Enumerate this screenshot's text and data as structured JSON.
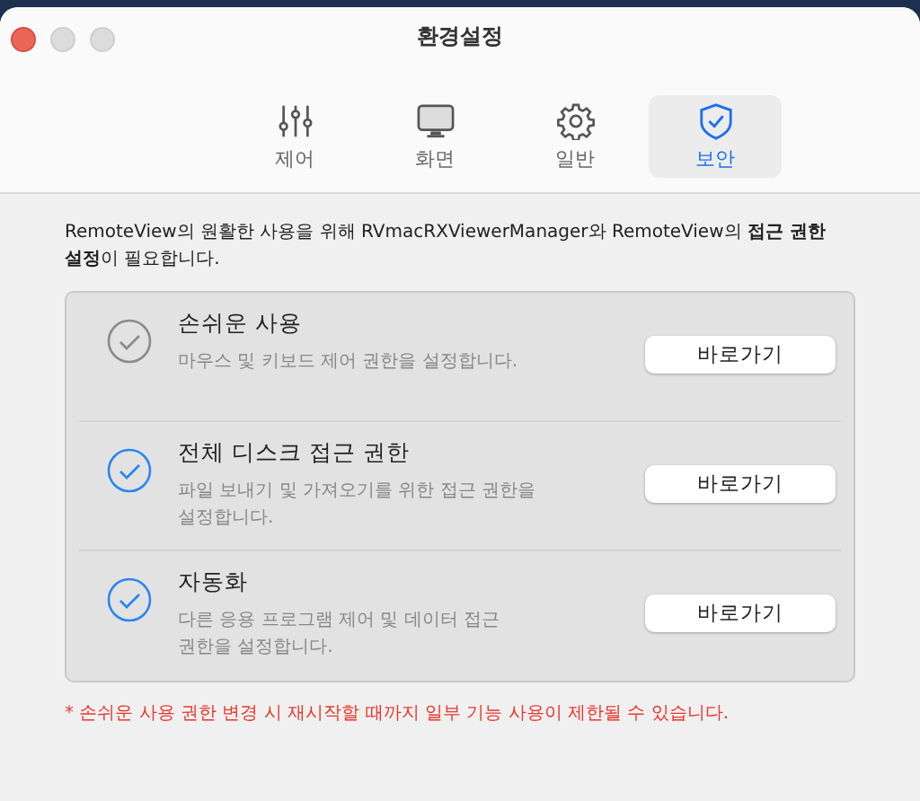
{
  "window": {
    "title": "환경설정"
  },
  "tabs": [
    {
      "label": "제어",
      "kind": "sliders",
      "selected": false
    },
    {
      "label": "화면",
      "kind": "monitor",
      "selected": false
    },
    {
      "label": "일반",
      "kind": "gear",
      "selected": false
    },
    {
      "label": "보안",
      "kind": "shield",
      "selected": true
    }
  ],
  "intro": "RemoteView의 원활한 사용을 위해 RVmacRXViewerManager와 RemoteView의 **접근 권한 설정**이 필요합니다.",
  "permissions": [
    {
      "title": "손쉬운 사용",
      "description": "마우스 및 키보드 제어 권한을 설정합니다.",
      "granted": false,
      "button": "바로가기"
    },
    {
      "title": "전체 디스크 접근 권한",
      "description": "파일 보내기 및 가져오기를 위한 접근 권한을 설정합니다.",
      "granted": true,
      "button": "바로가기"
    },
    {
      "title": "자동화",
      "description": "다른 응용 프로그램 제어 및 데이터 접근 권한을 설정합니다.",
      "granted": true,
      "button": "바로가기"
    }
  ],
  "note": "* 손쉬운 사용 권한 변경 시 재시작할 때까지 일부 기능 사용이 제한될 수 있습니다."
}
